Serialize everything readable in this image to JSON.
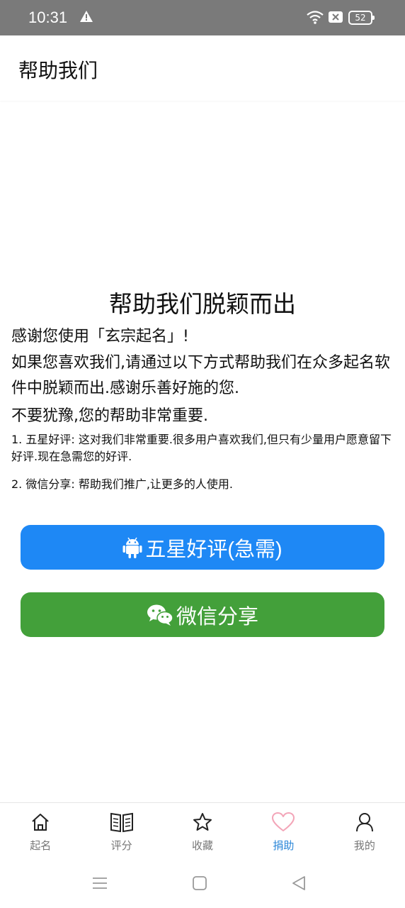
{
  "status_bar": {
    "time": "10:31",
    "battery": "52"
  },
  "app_bar": {
    "title": "帮助我们"
  },
  "content": {
    "heading": "帮助我们脱颖而出",
    "thanks": "感谢您使用「玄宗起名」!",
    "intro": "如果您喜欢我们,请通过以下方式帮助我们在众多起名软件中脱颖而出.感谢乐善好施的您.",
    "urge": "不要犹豫,您的帮助非常重要.",
    "item1": "1. 五星好评: 这对我们非常重要.很多用户喜欢我们,但只有少量用户愿意留下好评.现在急需您的好评.",
    "item2": "2. 微信分享: 帮助我们推广,让更多的人使用."
  },
  "buttons": {
    "rate": "五星好评(急需)",
    "share": "微信分享"
  },
  "nav": [
    {
      "label": "起名",
      "icon": "home-icon"
    },
    {
      "label": "评分",
      "icon": "book-icon"
    },
    {
      "label": "收藏",
      "icon": "star-icon"
    },
    {
      "label": "捐助",
      "icon": "heart-icon"
    },
    {
      "label": "我的",
      "icon": "person-icon"
    }
  ],
  "colors": {
    "rate_button": "#1e88f5",
    "share_button": "#43a03a",
    "nav_active": "#2a86d8",
    "heart_active": "#f3a5b8"
  }
}
